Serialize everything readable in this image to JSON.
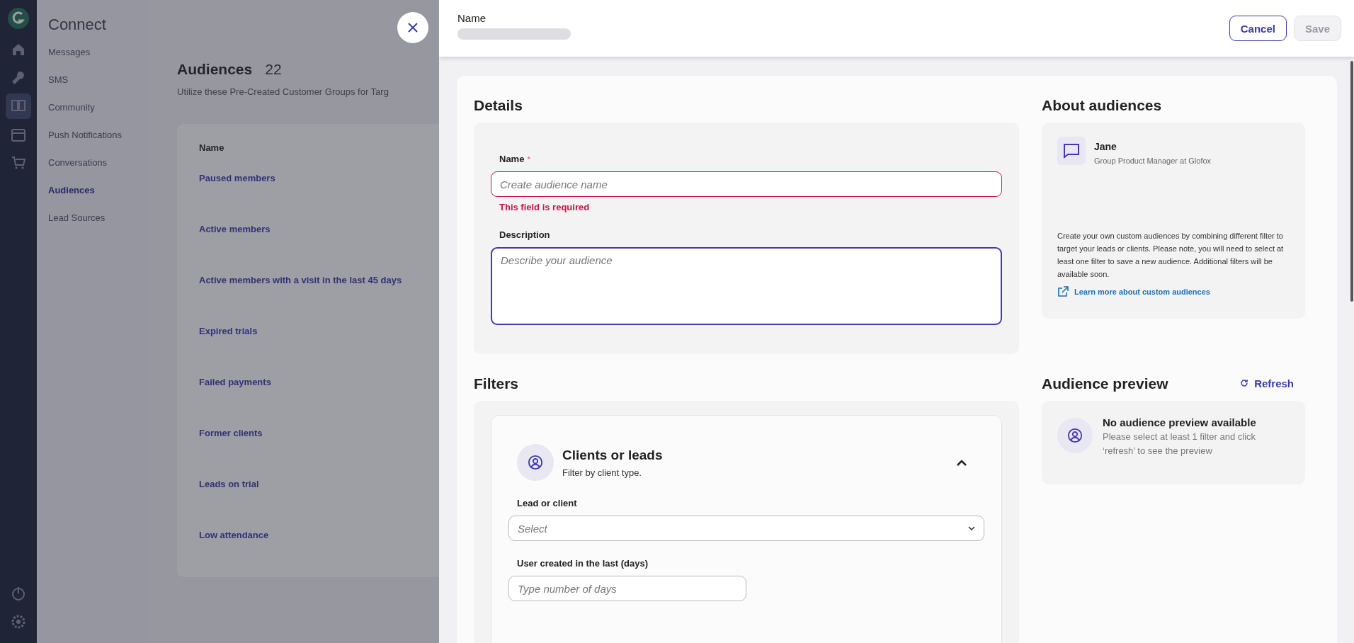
{
  "rail": {
    "items": [
      {
        "selected": false
      },
      {
        "selected": false
      },
      {
        "selected": true
      },
      {
        "selected": false
      },
      {
        "selected": false
      }
    ]
  },
  "sidebar": {
    "title": "Connect",
    "items": [
      {
        "label": "Messages",
        "selected": false
      },
      {
        "label": "SMS",
        "selected": false
      },
      {
        "label": "Community",
        "selected": false
      },
      {
        "label": "Push Notifications",
        "selected": false
      },
      {
        "label": "Conversations",
        "selected": false
      },
      {
        "label": "Audiences",
        "selected": true
      },
      {
        "label": "Lead Sources",
        "selected": false
      }
    ]
  },
  "page": {
    "title": "Audiences",
    "count": "22",
    "subtitle": "Utilize these Pre-Created Customer Groups for Targ",
    "table": {
      "columns": [
        "Name"
      ],
      "rows": [
        "Paused members",
        "Active members",
        "Active members with a visit in the last 45 days",
        "Expired trials",
        "Failed payments",
        "Former clients",
        "Leads on trial",
        "Low attendance"
      ]
    }
  },
  "drawer": {
    "header": {
      "label": "Name",
      "buttons": [
        {
          "label": "Cancel",
          "disabled": false
        },
        {
          "label": "Save",
          "disabled": true
        }
      ]
    },
    "details": {
      "title": "Details",
      "fields": [
        {
          "kind": "input",
          "label": "Name",
          "required_mark": "*",
          "placeholder": "Create audience name",
          "error": "This field is required"
        },
        {
          "kind": "textarea",
          "label": "Description",
          "placeholder": "Describe your audience",
          "focused": true
        }
      ]
    },
    "about": {
      "title": "About audiences",
      "author": "Jane",
      "role": "Group Product Manager at Glofox",
      "text": "Create your own custom audiences by combining different filter to target your leads or clients. Please note, you will need to select at least one filter to save a new audience. Additional filters will be available soon.",
      "link": "Learn more about custom audiences"
    },
    "filters": {
      "title": "Filters",
      "cards": [
        {
          "title": "Clients or leads",
          "subtitle": "Filter by client type.",
          "expanded": true,
          "fields": [
            {
              "kind": "select",
              "label": "Lead or client",
              "placeholder": "Select"
            },
            {
              "kind": "input",
              "label": "User created in the last (days)",
              "placeholder": "Type number of days"
            }
          ]
        }
      ]
    },
    "preview": {
      "title": "Audience preview",
      "action": "Refresh",
      "empty_title": "No audience preview available",
      "empty_text": "Please select at least 1 filter and click ‘refresh’ to see the preview"
    }
  }
}
